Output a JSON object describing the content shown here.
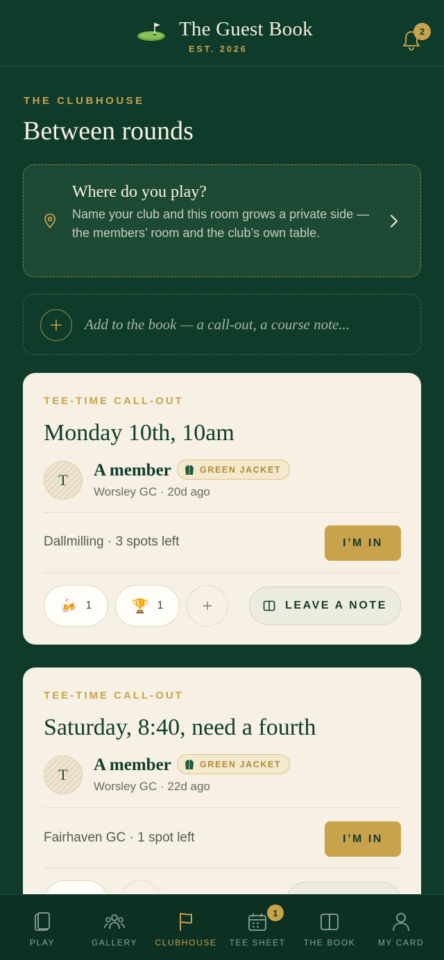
{
  "header": {
    "title": "The Guest Book",
    "subtitle": "EST. 2026",
    "notifications_count": "2"
  },
  "page": {
    "eyebrow": "THE CLUBHOUSE",
    "title": "Between rounds"
  },
  "club_prompt": {
    "title": "Where do you play?",
    "description": "Name your club and this room grows a private side — the members’ room and the club’s own table."
  },
  "composer": {
    "placeholder": "Add to the book — a call-out, a course note..."
  },
  "posts": [
    {
      "type": "TEE-TIME CALL-OUT",
      "title": "Monday 10th, 10am",
      "avatar_initial": "T",
      "author": "A member",
      "badge": "GREEN JACKET",
      "meta": "Worsley GC · 20d ago",
      "detail": "Dallmilling · 3 spots left",
      "action": "I’M IN",
      "reactions": [
        {
          "icon": "beer-cheers-icon",
          "emoji": "🍻",
          "count": "1"
        },
        {
          "icon": "trophy-icon",
          "emoji": "🏆",
          "count": "1"
        }
      ],
      "note_label": "LEAVE A NOTE"
    },
    {
      "type": "TEE-TIME CALL-OUT",
      "title": "Saturday, 8:40, need a fourth",
      "avatar_initial": "T",
      "author": "A member",
      "badge": "GREEN JACKET",
      "meta": "Worsley GC · 22d ago",
      "detail": "Fairhaven GC · 1 spot left",
      "action": "I’M IN"
    }
  ],
  "nav": {
    "items": [
      {
        "label": "PLAY",
        "icon": "cards-icon"
      },
      {
        "label": "GALLERY",
        "icon": "people-icon"
      },
      {
        "label": "CLUBHOUSE",
        "icon": "flag-icon",
        "active": true
      },
      {
        "label": "TEE SHEET",
        "icon": "calendar-icon",
        "badge": "1"
      },
      {
        "label": "THE BOOK",
        "icon": "book-icon"
      },
      {
        "label": "MY CARD",
        "icon": "user-icon"
      }
    ]
  },
  "colors": {
    "background": "#0e3b2a",
    "accent_gold": "#c9a24c",
    "card": "#f6f1e4",
    "ink_green": "#0f3d2b"
  }
}
